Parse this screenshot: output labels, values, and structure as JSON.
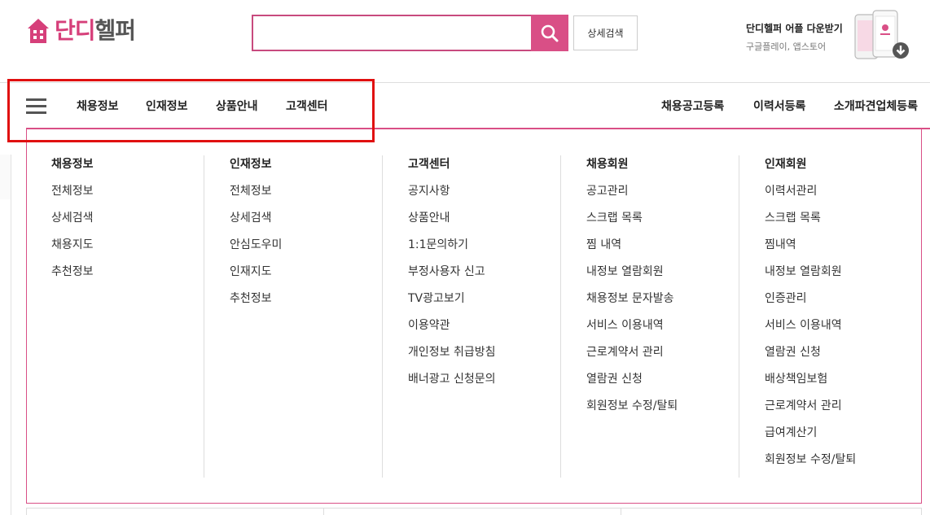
{
  "brand": {
    "logo_part1": "단디",
    "logo_part2": "헬퍼",
    "accent_color": "#d94f86"
  },
  "search": {
    "value": "",
    "placeholder": "",
    "submit_icon": "search-icon",
    "detail_label": "상세검색"
  },
  "app_promo": {
    "title": "단디헬퍼 어플 다운받기",
    "subtitle": "구글플레이, 앱스토어",
    "icon": "download-icon"
  },
  "nav": {
    "menu_icon": "hamburger-icon",
    "main": [
      "채용정보",
      "인재정보",
      "상품안내",
      "고객센터"
    ],
    "right": [
      "채용공고등록",
      "이력서등록",
      "소개파견업체등록"
    ]
  },
  "mega_menu": [
    {
      "title": "채용정보",
      "items": [
        "전체정보",
        "상세검색",
        "채용지도",
        "추천정보"
      ]
    },
    {
      "title": "인재정보",
      "items": [
        "전체정보",
        "상세검색",
        "안심도우미",
        "인재지도",
        "추천정보"
      ]
    },
    {
      "title": "고객센터",
      "items": [
        "공지사항",
        "상품안내",
        "1:1문의하기",
        "부정사용자 신고",
        "TV광고보기",
        "이용약관",
        "개인정보 취급방침",
        "배너광고 신청문의"
      ]
    },
    {
      "title": "채용회원",
      "items": [
        "공고관리",
        "스크랩 목록",
        "찜 내역",
        "내정보 열람회원",
        "채용정보 문자발송",
        "서비스 이용내역",
        "근로계약서 관리",
        "열람권 신청",
        "회원정보 수정/탈퇴"
      ]
    },
    {
      "title": "인재회원",
      "items": [
        "이력서관리",
        "스크랩 목록",
        "찜내역",
        "내정보 열람회원",
        "인증관리",
        "서비스 이용내역",
        "열람권 신청",
        "배상책임보험",
        "근로계약서 관리",
        "급여계산기",
        "회원정보 수정/탈퇴"
      ]
    }
  ]
}
